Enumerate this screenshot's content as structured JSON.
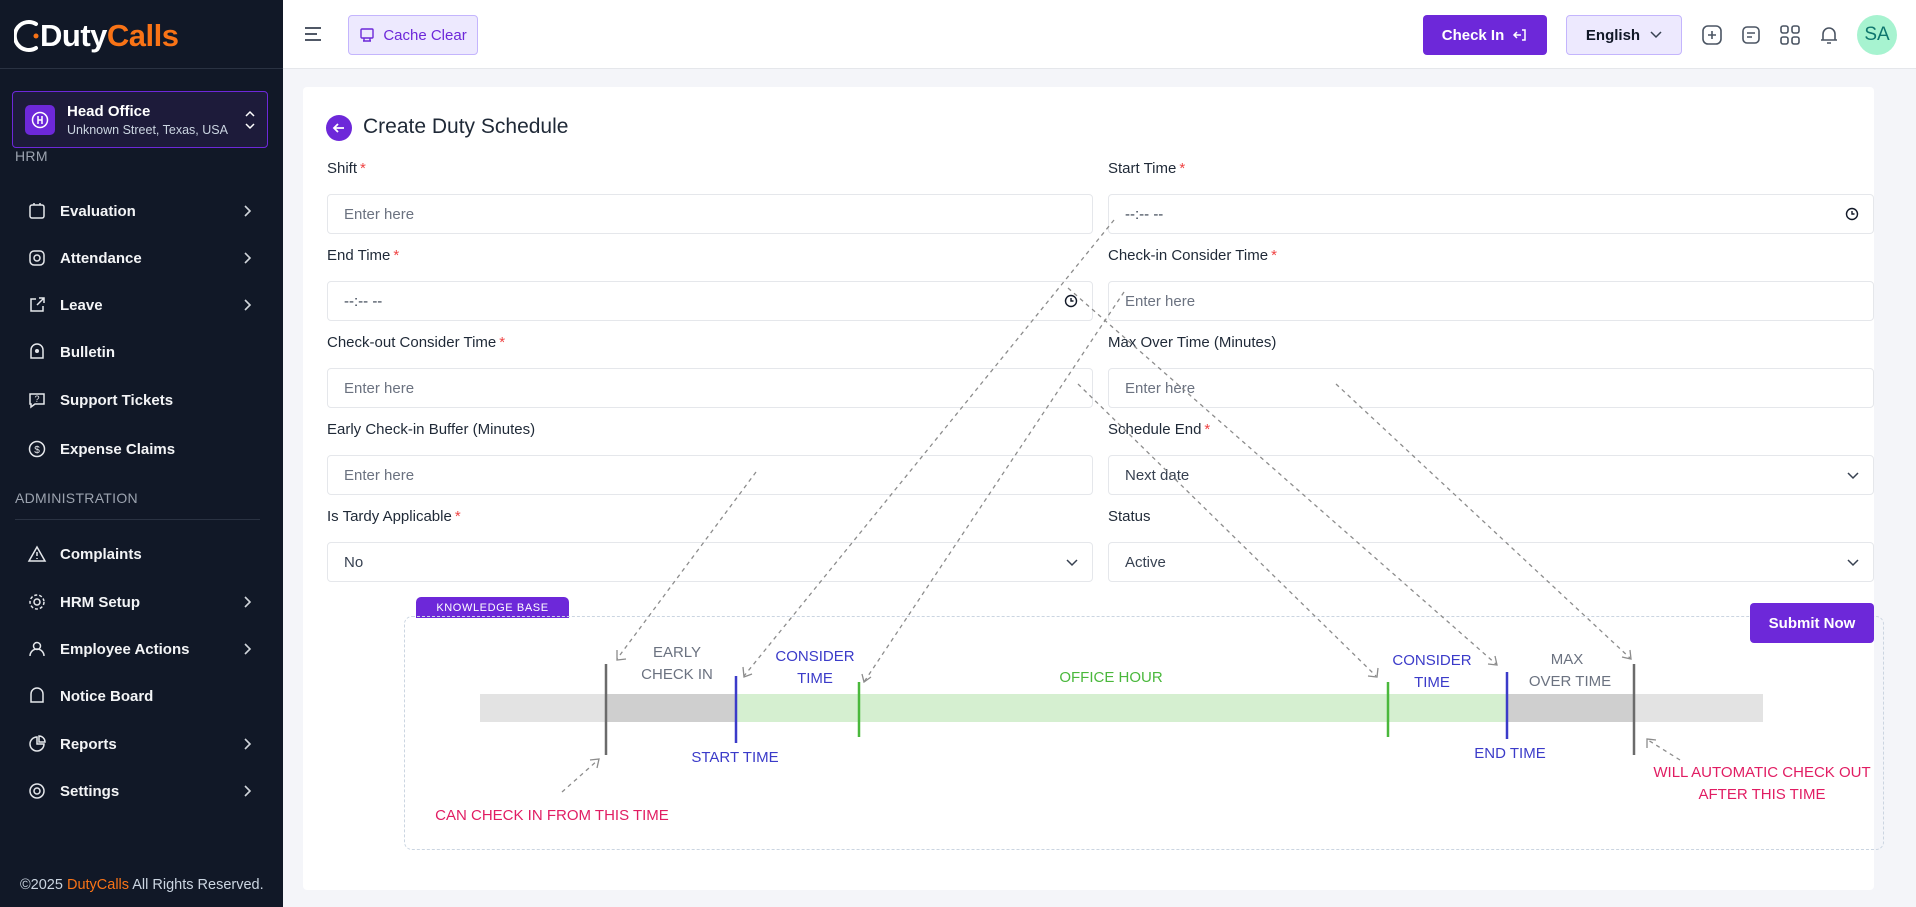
{
  "brand": {
    "name_part1": "Duty",
    "name_part2": "Calls"
  },
  "branch": {
    "name": "Head Office",
    "address": "Unknown Street, Texas, USA"
  },
  "sidebar": {
    "section_hrm": "HRM",
    "items_hrm": [
      {
        "label": "Evaluation",
        "icon": "clipboard-icon",
        "has_arrow": true
      },
      {
        "label": "Attendance",
        "icon": "fingerprint-icon",
        "has_arrow": true
      },
      {
        "label": "Leave",
        "icon": "external-link-icon",
        "has_arrow": true
      },
      {
        "label": "Bulletin",
        "icon": "bulletin-icon",
        "has_arrow": false
      },
      {
        "label": "Support Tickets",
        "icon": "help-chat-icon",
        "has_arrow": false
      },
      {
        "label": "Expense Claims",
        "icon": "dollar-circle-icon",
        "has_arrow": false
      }
    ],
    "section_admin": "ADMINISTRATION",
    "items_admin": [
      {
        "label": "Complaints",
        "icon": "warning-icon",
        "has_arrow": false
      },
      {
        "label": "HRM Setup",
        "icon": "cog-icon",
        "has_arrow": true
      },
      {
        "label": "Employee Actions",
        "icon": "user-icon",
        "has_arrow": true
      },
      {
        "label": "Notice Board",
        "icon": "notice-board-icon",
        "has_arrow": false
      },
      {
        "label": "Reports",
        "icon": "reports-icon",
        "has_arrow": true
      },
      {
        "label": "Settings",
        "icon": "gear-icon",
        "has_arrow": true
      }
    ]
  },
  "footer": {
    "prefix": "©2025 ",
    "brand": "DutyCalls",
    "suffix": " All Rights Reserved."
  },
  "topbar": {
    "cache_clear_label": "Cache Clear",
    "check_in_label": "Check In",
    "language_label": "English",
    "avatar_initials": "SA"
  },
  "page": {
    "title": "Create Duty Schedule",
    "submit_label": "Submit Now"
  },
  "form": {
    "shift": {
      "label": "Shift",
      "required": "*",
      "placeholder": "Enter here"
    },
    "start_time": {
      "label": "Start Time",
      "required": "*",
      "value": "--:-- --"
    },
    "end_time": {
      "label": "End Time",
      "required": "*",
      "value": "--:-- --"
    },
    "checkin_consider": {
      "label": "Check-in Consider Time",
      "required": "*",
      "placeholder": "Enter here"
    },
    "checkout_consider": {
      "label": "Check-out Consider Time",
      "required": "*",
      "placeholder": "Enter here"
    },
    "max_over_time": {
      "label": "Max Over Time (Minutes)",
      "placeholder": "Enter here"
    },
    "early_checkin": {
      "label": "Early Check-in Buffer (Minutes)",
      "placeholder": "Enter here"
    },
    "schedule_end": {
      "label": "Schedule End",
      "required": "*",
      "value": "Next date"
    },
    "tardy": {
      "label": "Is Tardy Applicable",
      "required": "*",
      "value": "No"
    },
    "status": {
      "label": "Status",
      "value": "Active"
    }
  },
  "knowledge_base": {
    "tag": "KNOWLEDGE BASE",
    "early_check_in": [
      "EARLY",
      "CHECK IN"
    ],
    "consider_time_1": [
      "CONSIDER",
      "TIME"
    ],
    "office_hour": "OFFICE HOUR",
    "consider_time_2": [
      "CONSIDER",
      "TIME"
    ],
    "max_over_time": [
      "MAX",
      "OVER TIME"
    ],
    "start_time": "START TIME",
    "end_time": "END TIME",
    "can_check_in": "CAN CHECK IN FROM THIS TIME",
    "auto_checkout": [
      "WILL AUTOMATIC CHECK OUT",
      "AFTER THIS TIME"
    ]
  },
  "colors": {
    "primary": "#6d28d9",
    "sidebar_bg": "#111827",
    "brand_orange": "#f97316",
    "required": "#ef4444",
    "kb_blue": "#3b3bc9",
    "kb_green": "#4ab83c",
    "kb_pink": "#e11d63"
  }
}
